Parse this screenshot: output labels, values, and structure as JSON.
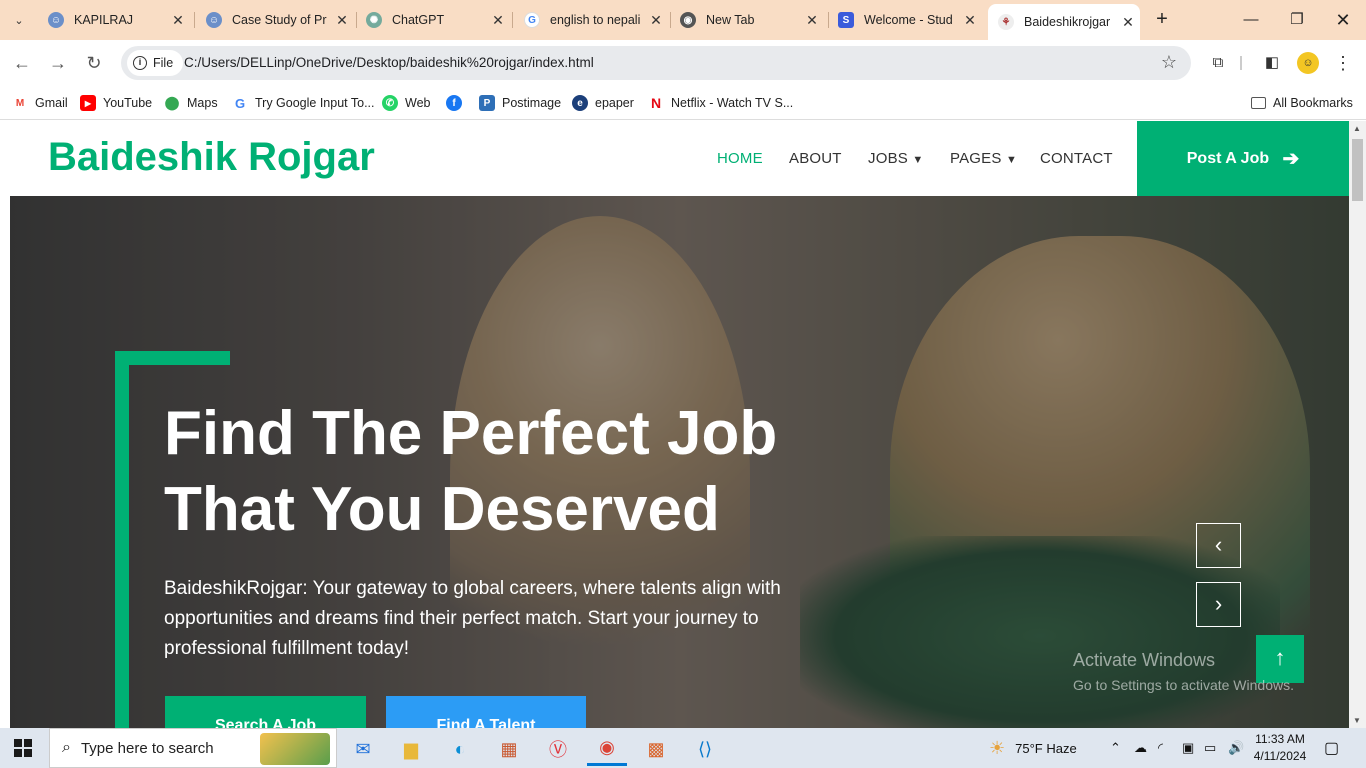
{
  "browser": {
    "tabs": [
      {
        "title": "KAPILRAJ",
        "icon": "user-icon"
      },
      {
        "title": "Case Study of Pr",
        "icon": "user-icon"
      },
      {
        "title": "ChatGPT",
        "icon": "chatgpt-icon"
      },
      {
        "title": "english to nepali",
        "icon": "google-icon"
      },
      {
        "title": "New Tab",
        "icon": "chrome-icon"
      },
      {
        "title": "Welcome - Stud",
        "icon": "s-icon"
      },
      {
        "title": "Baideshikrojgar",
        "icon": "page-icon"
      }
    ],
    "active_tab_index": 6,
    "file_chip": "File",
    "url": "C:/Users/DELLinp/OneDrive/Desktop/baideshik%20rojgar/index.html",
    "bookmarks": [
      {
        "label": "Gmail",
        "color": "#ea4335",
        "glyph": "M"
      },
      {
        "label": "YouTube",
        "color": "#ff0000",
        "glyph": "▶"
      },
      {
        "label": "Maps",
        "color": "#34a853",
        "glyph": "●"
      },
      {
        "label": "Try Google Input To...",
        "color": "#4285f4",
        "glyph": "G"
      },
      {
        "label": "Web",
        "color": "#25d366",
        "glyph": "✆"
      },
      {
        "label": "",
        "color": "#1877f2",
        "glyph": "f"
      },
      {
        "label": "Postimage",
        "color": "#2e6fb7",
        "glyph": "P"
      },
      {
        "label": "epaper",
        "color": "#1c3f7a",
        "glyph": "e"
      },
      {
        "label": "Netflix - Watch TV S...",
        "color": "#e50914",
        "glyph": "N"
      }
    ],
    "all_bookmarks": "All Bookmarks"
  },
  "site": {
    "brand": "Baideshik Rojgar",
    "menu": [
      "HOME",
      "ABOUT",
      "JOBS",
      "PAGES",
      "CONTACT"
    ],
    "post_job": "Post A Job",
    "hero_title_line1": "Find The Perfect Job",
    "hero_title_line2": "That You Deserved",
    "hero_text": "BaideshikRojgar: Your gateway to global careers, where talents align with opportunities and dreams find their perfect match. Start your journey to professional fulfillment today!",
    "search_job": "Search A Job",
    "find_talent": "Find A Talent",
    "accent": "#00b074",
    "accent2": "#2c9cf5"
  },
  "watermark": {
    "line1": "Activate Windows",
    "line2": "Go to Settings to activate Windows."
  },
  "taskbar": {
    "search_placeholder": "Type here to search",
    "weather": "75°F  Haze",
    "time": "11:33 AM",
    "date": "4/11/2024"
  }
}
